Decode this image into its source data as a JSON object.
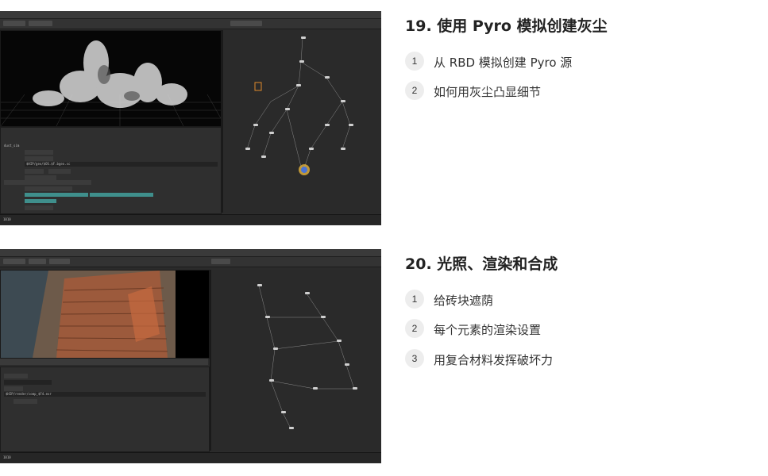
{
  "sections": [
    {
      "title": "19. 使用 Pyro 模拟创建灰尘",
      "items": [
        {
          "num": "1",
          "label": "从 RBD 模拟创建 Pyro 源"
        },
        {
          "num": "2",
          "label": "如何用灰尘凸显细节"
        }
      ]
    },
    {
      "title": "20. 光照、渲染和合成",
      "items": [
        {
          "num": "1",
          "label": "给砖块遮荫"
        },
        {
          "num": "2",
          "label": "每个元素的渲染设置"
        },
        {
          "num": "3",
          "label": "用复合材料发挥破坏力"
        }
      ]
    }
  ],
  "screenshots": {
    "shot1": {
      "node_name": "dust_sim",
      "path_field": "$HIP/geo/$OS.$F.bgeo.sc",
      "frame": "1010"
    },
    "shot2": {
      "node_name": "$HIP/render/comp_$F4.exr",
      "frame": "1010"
    }
  },
  "colors": {
    "accent_teal": "#3f8f8c",
    "app_bg": "#2b2b2b",
    "number_badge": "#ededed"
  }
}
